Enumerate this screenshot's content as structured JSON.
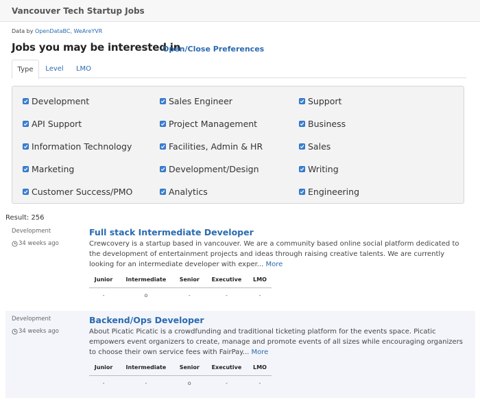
{
  "header": {
    "brand": "Vancouver Tech Startup Jobs"
  },
  "attribution": {
    "prefix": "Data by ",
    "link_text": "OpenDataBC, WeAreYVR"
  },
  "section": {
    "title": "Jobs you may be interested in",
    "prefs_link": "Open/Close Preferences"
  },
  "tabs": [
    {
      "label": "Type",
      "active": true
    },
    {
      "label": "Level",
      "active": false
    },
    {
      "label": "LMO",
      "active": false
    }
  ],
  "preferences": {
    "col1": [
      {
        "label": "Development",
        "checked": true
      },
      {
        "label": "API Support",
        "checked": true
      },
      {
        "label": "Information Technology",
        "checked": true
      },
      {
        "label": "Marketing",
        "checked": true
      },
      {
        "label": "Customer Success/PMO",
        "checked": true
      }
    ],
    "col2": [
      {
        "label": "Sales Engineer",
        "checked": true
      },
      {
        "label": "Project Management",
        "checked": true
      },
      {
        "label": "Facilities, Admin & HR",
        "checked": true
      },
      {
        "label": "Development/Design",
        "checked": true
      },
      {
        "label": "Analytics",
        "checked": true
      }
    ],
    "col3": [
      {
        "label": "Support",
        "checked": true
      },
      {
        "label": "Business",
        "checked": true
      },
      {
        "label": "Sales",
        "checked": true
      },
      {
        "label": "Writing",
        "checked": true
      },
      {
        "label": "Engineering",
        "checked": true
      }
    ]
  },
  "results": {
    "label": "Result: 256"
  },
  "level_headers": [
    "Junior",
    "Intermediate",
    "Senior",
    "Executive",
    "LMO"
  ],
  "jobs": [
    {
      "category": "Development",
      "age": "34 weeks ago",
      "title": "Full stack Intermediate Developer",
      "description": "Crewcovery is a startup based in vancouver. We are a community based online social platform dedicated to the development of entertainment projects and ideas through raising creative talents. We are currently looking for an intermediate developer with exper...",
      "more": "More",
      "levels": [
        "-",
        "o",
        "-",
        "-",
        "-"
      ]
    },
    {
      "category": "Development",
      "age": "34 weeks ago",
      "title": "Backend/Ops Developer",
      "description": "About Picatic Picatic is a crowdfunding and traditional ticketing platform for the events space. Picatic empowers event organizers to create, manage and promote events of all sizes while encouraging organizers to choose their own service fees with FairPay...",
      "more": "More",
      "levels": [
        "-",
        "-",
        "o",
        "-",
        "-"
      ]
    }
  ],
  "colors": {
    "link": "#2a6ab0",
    "checkbox": "#3b82d6",
    "panel": "#f3f3f3",
    "alt_row": "#f3f5fa"
  },
  "icons": {
    "checkbox": "checkmark-icon",
    "age": "clock-icon"
  }
}
